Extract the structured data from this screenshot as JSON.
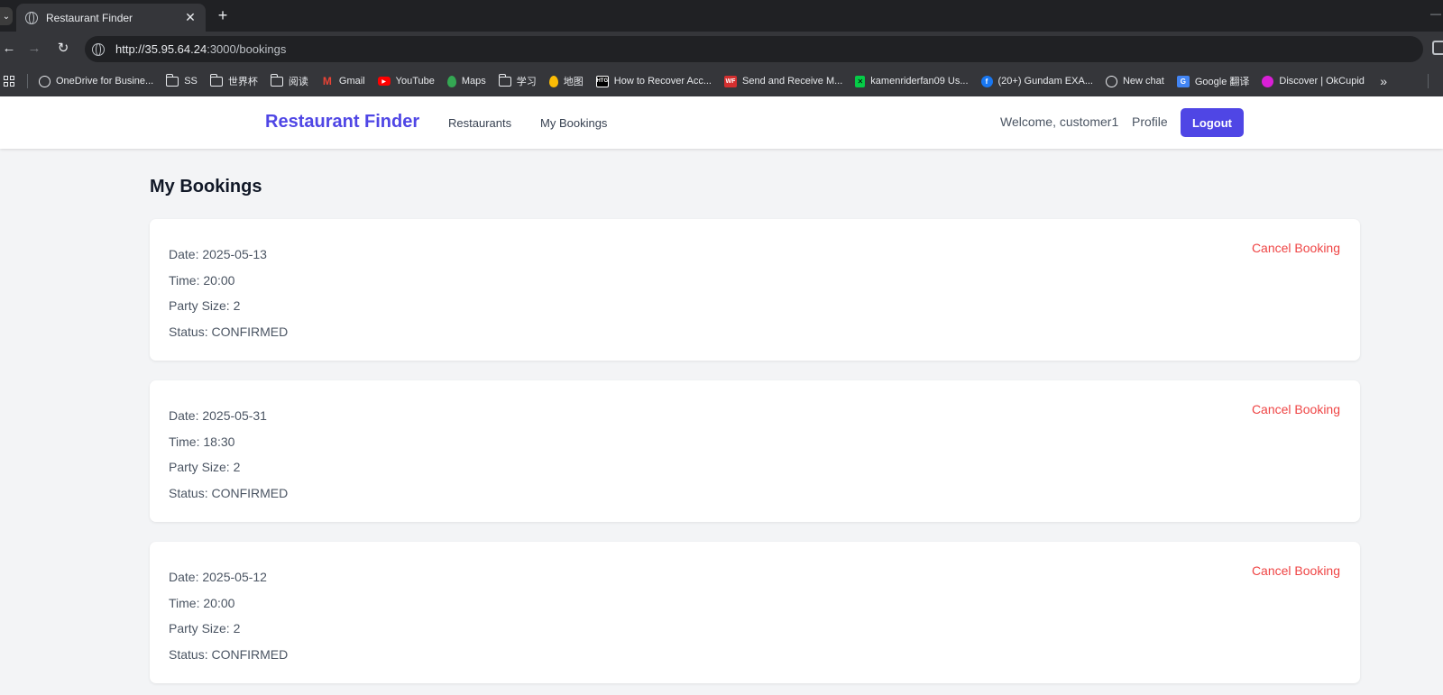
{
  "browser": {
    "tab_title": "Restaurant Finder",
    "url_host": "http://35.95.64.24",
    "url_rest": ":3000/bookings",
    "bookmarks": [
      {
        "label": "OneDrive for Busine...",
        "icon": "globe-icon"
      },
      {
        "label": "SS",
        "icon": "folder-icon"
      },
      {
        "label": "世界杯",
        "icon": "folder-icon"
      },
      {
        "label": "阅读",
        "icon": "folder-icon"
      },
      {
        "label": "Gmail",
        "icon": "gmail-icon"
      },
      {
        "label": "YouTube",
        "icon": "youtube-icon"
      },
      {
        "label": "Maps",
        "icon": "maps-icon"
      },
      {
        "label": "学习",
        "icon": "folder-icon"
      },
      {
        "label": "地图",
        "icon": "maps-icon"
      },
      {
        "label": "How to Recover Acc...",
        "icon": "htg-icon"
      },
      {
        "label": "Send and Receive M...",
        "icon": "wf-icon"
      },
      {
        "label": "kamenriderfan09 Us...",
        "icon": "deviantart-icon"
      },
      {
        "label": "(20+) Gundam EXA...",
        "icon": "facebook-icon"
      },
      {
        "label": "New chat",
        "icon": "openai-icon"
      },
      {
        "label": "Google 翻译",
        "icon": "translate-icon"
      },
      {
        "label": "Discover | OkCupid",
        "icon": "okcupid-icon"
      }
    ],
    "colors": {
      "chrome_dark": "#202124",
      "chrome_toolbar": "#35363a"
    }
  },
  "nav": {
    "brand": "Restaurant Finder",
    "links": [
      "Restaurants",
      "My Bookings"
    ],
    "welcome": "Welcome, customer1",
    "profile": "Profile",
    "logout": "Logout",
    "colors": {
      "accent": "#4f46e5"
    }
  },
  "main": {
    "title": "My Bookings",
    "cancel_label": "Cancel Booking",
    "cancel_color": "#ef4444",
    "bookings": [
      {
        "date": "Date: 2025-05-13",
        "time": "Time: 20:00",
        "party": "Party Size: 2",
        "status": "Status: CONFIRMED"
      },
      {
        "date": "Date: 2025-05-31",
        "time": "Time: 18:30",
        "party": "Party Size: 2",
        "status": "Status: CONFIRMED"
      },
      {
        "date": "Date: 2025-05-12",
        "time": "Time: 20:00",
        "party": "Party Size: 2",
        "status": "Status: CONFIRMED"
      }
    ]
  }
}
